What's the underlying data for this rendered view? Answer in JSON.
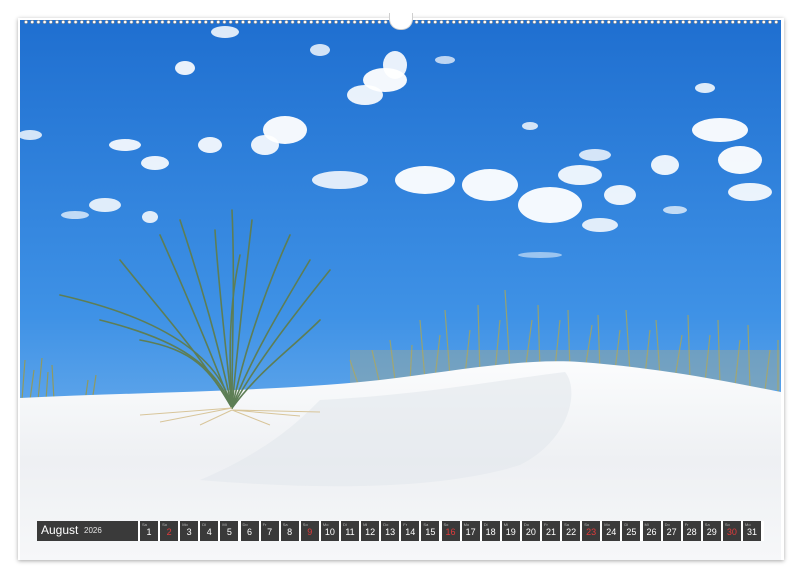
{
  "calendar": {
    "month": "August",
    "year": "2026",
    "days": [
      {
        "num": "1",
        "abbr": "Sa",
        "red": false
      },
      {
        "num": "2",
        "abbr": "So",
        "red": true
      },
      {
        "num": "3",
        "abbr": "Mo",
        "red": false
      },
      {
        "num": "4",
        "abbr": "Di",
        "red": false
      },
      {
        "num": "5",
        "abbr": "Mi",
        "red": false
      },
      {
        "num": "6",
        "abbr": "Do",
        "red": false
      },
      {
        "num": "7",
        "abbr": "Fr",
        "red": false
      },
      {
        "num": "8",
        "abbr": "Sa",
        "red": false
      },
      {
        "num": "9",
        "abbr": "So",
        "red": true
      },
      {
        "num": "10",
        "abbr": "Mo",
        "red": false
      },
      {
        "num": "11",
        "abbr": "Di",
        "red": false
      },
      {
        "num": "12",
        "abbr": "Mi",
        "red": false
      },
      {
        "num": "13",
        "abbr": "Do",
        "red": false
      },
      {
        "num": "14",
        "abbr": "Fr",
        "red": false
      },
      {
        "num": "15",
        "abbr": "Sa",
        "red": false
      },
      {
        "num": "16",
        "abbr": "So",
        "red": true
      },
      {
        "num": "17",
        "abbr": "Mo",
        "red": false
      },
      {
        "num": "18",
        "abbr": "Di",
        "red": false
      },
      {
        "num": "19",
        "abbr": "Mi",
        "red": false
      },
      {
        "num": "20",
        "abbr": "Do",
        "red": false
      },
      {
        "num": "21",
        "abbr": "Fr",
        "red": false
      },
      {
        "num": "22",
        "abbr": "Sa",
        "red": false
      },
      {
        "num": "23",
        "abbr": "So",
        "red": true
      },
      {
        "num": "24",
        "abbr": "Mo",
        "red": false
      },
      {
        "num": "25",
        "abbr": "Di",
        "red": false
      },
      {
        "num": "26",
        "abbr": "Mi",
        "red": false
      },
      {
        "num": "27",
        "abbr": "Do",
        "red": false
      },
      {
        "num": "28",
        "abbr": "Fr",
        "red": false
      },
      {
        "num": "29",
        "abbr": "Sa",
        "red": false
      },
      {
        "num": "30",
        "abbr": "So",
        "red": true
      },
      {
        "num": "31",
        "abbr": "Mo",
        "red": false
      }
    ]
  },
  "photo": {
    "subject": "white sand dune with yucca plant and dune grass under blue sky with clouds",
    "sky_color": "#2f7fd8",
    "sand_color": "#f3f4f6"
  }
}
